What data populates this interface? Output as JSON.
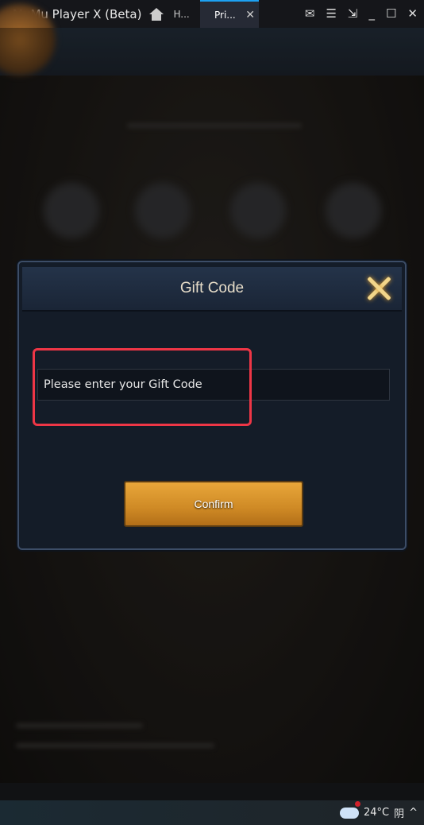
{
  "titlebar": {
    "app_title": "MuMu Player X  (Beta)",
    "tabs": [
      {
        "label": "H..."
      },
      {
        "label": "Pri..."
      }
    ],
    "controls": [
      "mail-icon",
      "menu-icon",
      "resize-icon",
      "minimize-icon",
      "maximize-icon",
      "close-icon"
    ]
  },
  "dialog": {
    "title": "Gift Code",
    "input_placeholder": "Please enter your Gift Code",
    "confirm_label": "Confirm",
    "highlight_color": "#ee3646"
  },
  "taskbar": {
    "temperature": "24°C",
    "weather": "阴"
  }
}
